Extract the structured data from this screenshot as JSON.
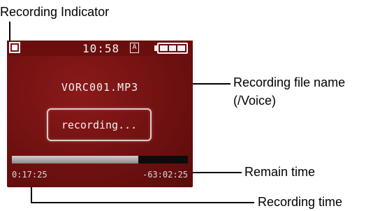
{
  "labels": {
    "recording_indicator": "Recording Indicator",
    "recording_file_name_line1": "Recording file name",
    "recording_file_name_line2": "(/Voice)",
    "remain_time": "Remain time",
    "recording_time": "Recording time"
  },
  "device": {
    "clock": "10:58",
    "ampm_indicator": "A",
    "battery_segments": 3,
    "filename": "VORC001.MP3",
    "status_text": "recording...",
    "progress_fraction": 0.72,
    "elapsed_time": "0:17:25",
    "remain_time": "-63:02:25"
  },
  "colors": {
    "screen_background": "#7a1414",
    "text": "#f2f2f2"
  }
}
